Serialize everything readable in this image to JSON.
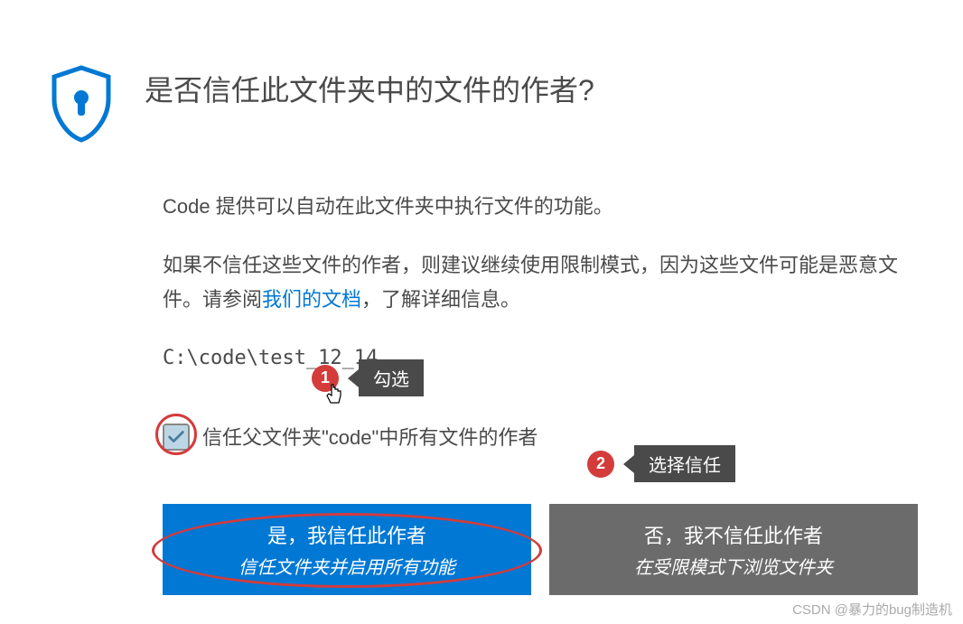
{
  "dialog": {
    "title": "是否信任此文件夹中的文件的作者?",
    "para1": "Code 提供可以自动在此文件夹中执行文件的功能。",
    "para2_pre": "如果不信任这些文件的作者，则建议继续使用限制模式，因为这些文件可能是恶意文件。请参阅",
    "para2_link": "我们的文档",
    "para2_post": "，了解详细信息。",
    "path": "C:\\code\\test_12_14",
    "checkbox_label": "信任父文件夹\"code\"中所有文件的作者",
    "trust_button": {
      "title": "是，我信任此作者",
      "subtitle": "信任文件夹并启用所有功能"
    },
    "no_trust_button": {
      "title": "否，我不信任此作者",
      "subtitle": "在受限模式下浏览文件夹"
    }
  },
  "annotations": {
    "one": {
      "num": "1",
      "label": "勾选"
    },
    "two": {
      "num": "2",
      "label": "选择信任"
    }
  },
  "watermark": "CSDN @暴力的bug制造机"
}
